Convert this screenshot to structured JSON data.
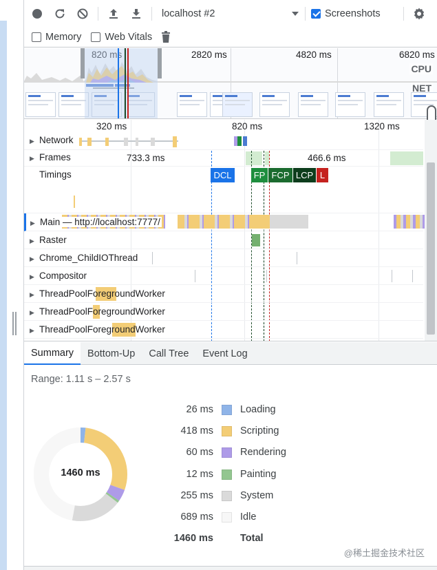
{
  "toolbar": {
    "target_select": "localhost #2",
    "screenshots_label": "Screenshots",
    "screenshots_checked": true,
    "memory_label": "Memory",
    "webvitals_label": "Web Vitals"
  },
  "overview": {
    "ticks": [
      "820 ms",
      "2820 ms",
      "4820 ms",
      "6820 ms"
    ],
    "cpu_label": "CPU",
    "net_label": "NET"
  },
  "timeline": {
    "ticks": [
      "320 ms",
      "820 ms",
      "1320 ms"
    ],
    "frames_left": "733.3 ms",
    "frames_right": "466.6 ms",
    "markers": [
      "DCL",
      "FP",
      "FCP",
      "LCP",
      "L"
    ],
    "marker_colors": {
      "DCL": "#1a73e8",
      "FP": "#1e8e3e",
      "FCP": "#1b6b2f",
      "LCP": "#0d3d1c",
      "L": "#c5221f"
    },
    "tracks": {
      "network": "Network",
      "frames": "Frames",
      "timings": "Timings",
      "main": "Main — http://localhost:7777/",
      "raster": "Raster",
      "childio": "Chrome_ChildIOThread",
      "compositor": "Compositor",
      "pool1": "ThreadPoolForegroundWorker",
      "pool2": "ThreadPoolForegroundWorker",
      "pool3": "ThreadPoolForegroundWorker"
    }
  },
  "tabs": [
    "Summary",
    "Bottom-Up",
    "Call Tree",
    "Event Log"
  ],
  "summary": {
    "range": "Range: 1.11 s – 2.57 s",
    "total_center": "1460 ms",
    "rows": [
      {
        "value": "26 ms",
        "name": "Loading",
        "color": "#8fb4e8"
      },
      {
        "value": "418 ms",
        "name": "Scripting",
        "color": "#f3cd76"
      },
      {
        "value": "60 ms",
        "name": "Rendering",
        "color": "#ae9be8"
      },
      {
        "value": "12 ms",
        "name": "Painting",
        "color": "#93c690"
      },
      {
        "value": "255 ms",
        "name": "System",
        "color": "#dadada"
      },
      {
        "value": "689 ms",
        "name": "Idle",
        "color": "#f7f7f7"
      }
    ],
    "total_value": "1460 ms",
    "total_label": "Total",
    "donut_ms": {
      "Loading": 26,
      "Scripting": 418,
      "Rendering": 60,
      "Painting": 12,
      "System": 255,
      "Idle": 689
    }
  },
  "watermark": "@稀土掘金技术社区"
}
